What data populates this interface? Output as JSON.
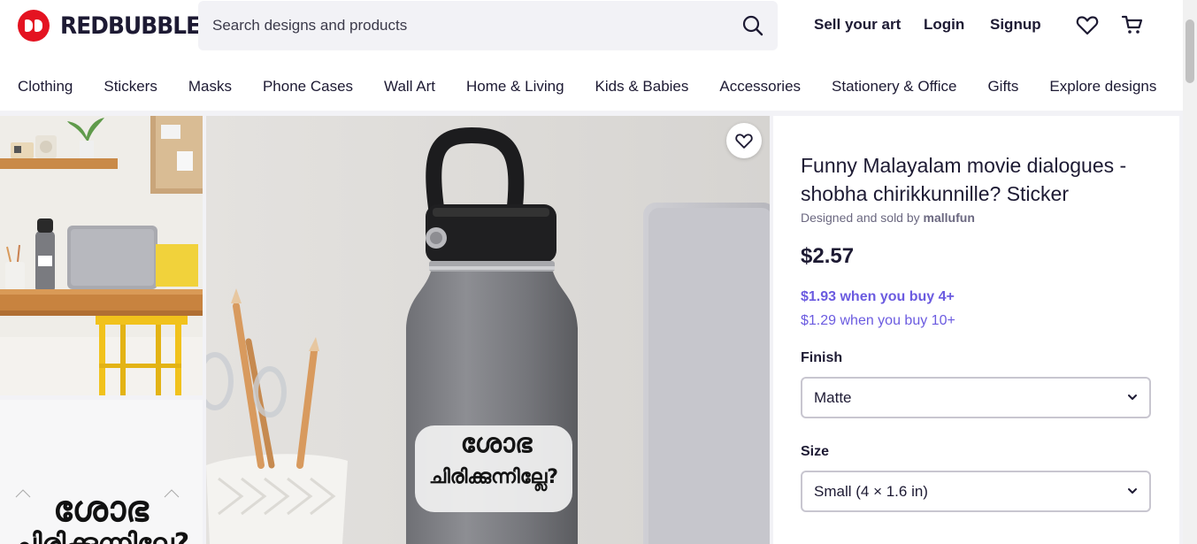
{
  "brand": {
    "name": "REDBUBBLE"
  },
  "search": {
    "placeholder": "Search designs and products"
  },
  "header_links": {
    "sell": "Sell your art",
    "login": "Login",
    "signup": "Signup"
  },
  "categories": [
    "Clothing",
    "Stickers",
    "Masks",
    "Phone Cases",
    "Wall Art",
    "Home & Living",
    "Kids & Babies",
    "Accessories",
    "Stationery & Office",
    "Gifts",
    "Explore designs"
  ],
  "sticker_text": {
    "line1": "ശോഭ",
    "line2": "ചിരിക്കുന്നില്ലേ?"
  },
  "product": {
    "title": "Funny Malayalam movie dialogues - shobha chirikkunnille? Sticker",
    "byline_prefix": "Designed and sold by",
    "artist": "mallufun",
    "price": "$2.57",
    "bulk_price_1": "$1.93 when you buy 4+",
    "bulk_price_2": "$1.29 when you buy 10+",
    "finish_label": "Finish",
    "finish_value": "Matte",
    "size_label": "Size",
    "size_value": "Small (4 × 1.6 in)"
  },
  "colors": {
    "brand_red": "#e41321",
    "accent_purple": "#6b5be0",
    "text_dark": "#1d1a33"
  }
}
